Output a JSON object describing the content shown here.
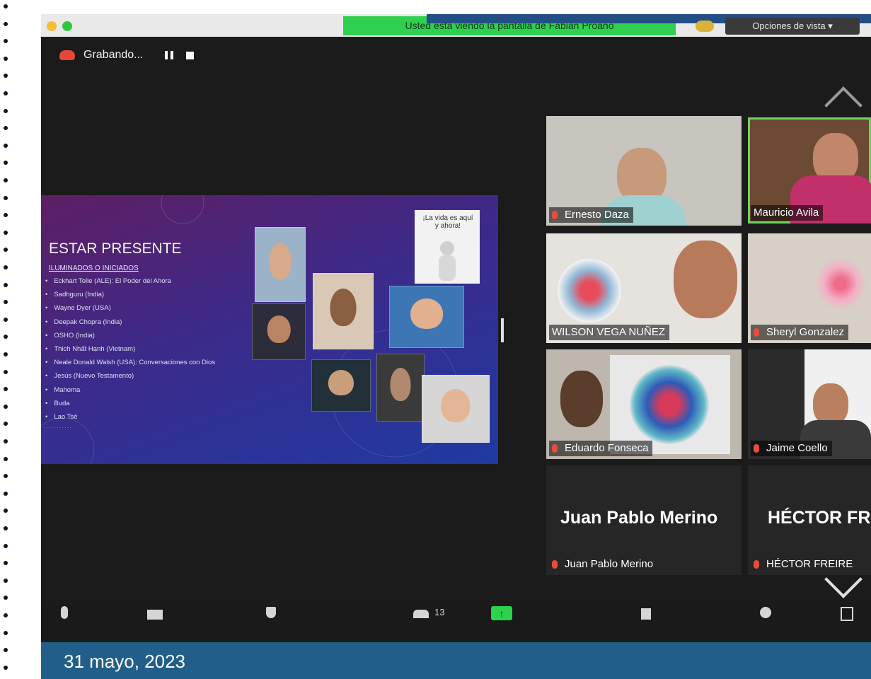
{
  "zoom": {
    "banner_text": "Usted está viendo la pantalla de Fabián Proaño",
    "view_options_label": "Opciones de vista",
    "view_options_chevron": "▾",
    "recording_label": "Grabando...",
    "participants_count": "13",
    "share_icon_glyph": "↑"
  },
  "slide": {
    "title": "ESTAR PRESENTE",
    "subtitle": "ILUMINADOS O INICIADOS",
    "items": [
      "Eckhart Tolle (ALE): El Poder del Ahora",
      "Sadhguru (India)",
      "Wayne Dyer (USA)",
      "Deepak Chopra (India)",
      "OSHO (India)",
      "Thich Nhất Hạnh (Vietnam)",
      "Neale Donald Walsh (USA): Conversaciones con Dios",
      "Jesús (Nuevo Testamento)",
      "Mahoma",
      "Buda",
      "Lao Tsé"
    ],
    "sign_text": "¡La vida es aquí y ahora!"
  },
  "participants": [
    {
      "name": "Ernesto Daza",
      "muted": true
    },
    {
      "name": "Mauricio Avila",
      "muted": false,
      "active_speaker": true
    },
    {
      "name": "WILSON VEGA NUÑEZ",
      "muted": false
    },
    {
      "name": "Sheryl Gonzalez",
      "muted": true
    },
    {
      "name": "Eduardo Fonseca",
      "muted": true
    },
    {
      "name": "Jaime Coello",
      "muted": true
    },
    {
      "name": "Juan Pablo Merino",
      "display_name": "Juan Pablo Merino",
      "muted": true,
      "video": false
    },
    {
      "name": "HÉCTOR FREIRE",
      "display_name": "HÉCTOR FR",
      "muted": true,
      "video": false
    }
  ],
  "footer": {
    "date": "31 mayo, 2023"
  },
  "colors": {
    "zoom_green": "#2fd04f",
    "active_speaker_border": "#6cd35b",
    "footer_blue": "#215f8a"
  }
}
